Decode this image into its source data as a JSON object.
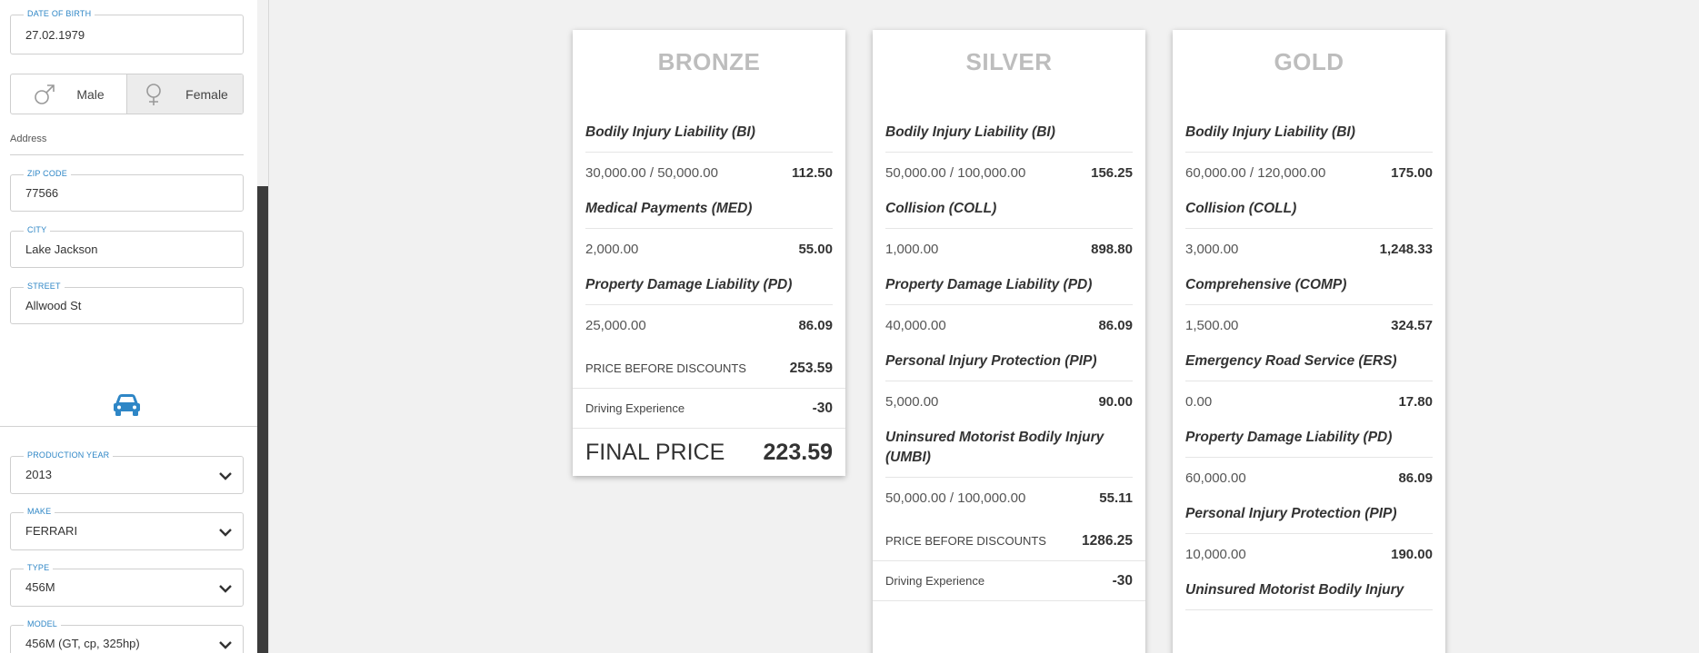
{
  "sidebar": {
    "dob": {
      "label": "DATE OF BIRTH",
      "value": "27.02.1979"
    },
    "gender": {
      "male": "Male",
      "female": "Female",
      "selected": "Female"
    },
    "address_label": "Address",
    "zip": {
      "label": "ZIP CODE",
      "value": "77566"
    },
    "city": {
      "label": "CITY",
      "value": "Lake Jackson"
    },
    "street": {
      "label": "STREET",
      "value": "Allwood St"
    },
    "vehicle_icon": "car-icon",
    "production_year": {
      "label": "PRODUCTION YEAR",
      "value": "2013"
    },
    "make": {
      "label": "MAKE",
      "value": "FERRARI"
    },
    "type": {
      "label": "TYPE",
      "value": "456M"
    },
    "model": {
      "label": "MODEL",
      "value": "456M (GT, cp, 325hp)"
    }
  },
  "colors": {
    "accent": "#2e86c6",
    "title": "#bdbdbd"
  },
  "plans": [
    {
      "name": "BRONZE",
      "coverages": [
        {
          "name": "Bodily Injury Liability (BI)",
          "limit": "30,000.00 / 50,000.00",
          "price": "112.50"
        },
        {
          "name": "Medical Payments (MED)",
          "limit": "2,000.00",
          "price": "55.00"
        },
        {
          "name": "Property Damage Liability (PD)",
          "limit": "25,000.00",
          "price": "86.09"
        }
      ],
      "price_before_label": "PRICE BEFORE DISCOUNTS",
      "price_before": "253.59",
      "discount_label": "Driving Experience",
      "discount": "-30",
      "final_label": "FINAL PRICE",
      "final_price": "223.59"
    },
    {
      "name": "SILVER",
      "coverages": [
        {
          "name": "Bodily Injury Liability (BI)",
          "limit": "50,000.00 / 100,000.00",
          "price": "156.25"
        },
        {
          "name": "Collision (COLL)",
          "limit": "1,000.00",
          "price": "898.80"
        },
        {
          "name": "Property Damage Liability (PD)",
          "limit": "40,000.00",
          "price": "86.09"
        },
        {
          "name": "Personal Injury Protection (PIP)",
          "limit": "5,000.00",
          "price": "90.00"
        },
        {
          "name": "Uninsured Motorist Bodily Injury (UMBI)",
          "limit": "50,000.00 / 100,000.00",
          "price": "55.11"
        }
      ],
      "price_before_label": "PRICE BEFORE DISCOUNTS",
      "price_before": "1286.25",
      "discount_label": "Driving Experience",
      "discount": "-30"
    },
    {
      "name": "GOLD",
      "coverages": [
        {
          "name": "Bodily Injury Liability (BI)",
          "limit": "60,000.00 / 120,000.00",
          "price": "175.00"
        },
        {
          "name": "Collision (COLL)",
          "limit": "3,000.00",
          "price": "1,248.33"
        },
        {
          "name": "Comprehensive (COMP)",
          "limit": "1,500.00",
          "price": "324.57"
        },
        {
          "name": "Emergency Road Service (ERS)",
          "limit": "0.00",
          "price": "17.80"
        },
        {
          "name": "Property Damage Liability (PD)",
          "limit": "60,000.00",
          "price": "86.09"
        },
        {
          "name": "Personal Injury Protection (PIP)",
          "limit": "10,000.00",
          "price": "190.00"
        },
        {
          "name": "Uninsured Motorist Bodily Injury",
          "limit": "",
          "price": ""
        }
      ]
    }
  ]
}
